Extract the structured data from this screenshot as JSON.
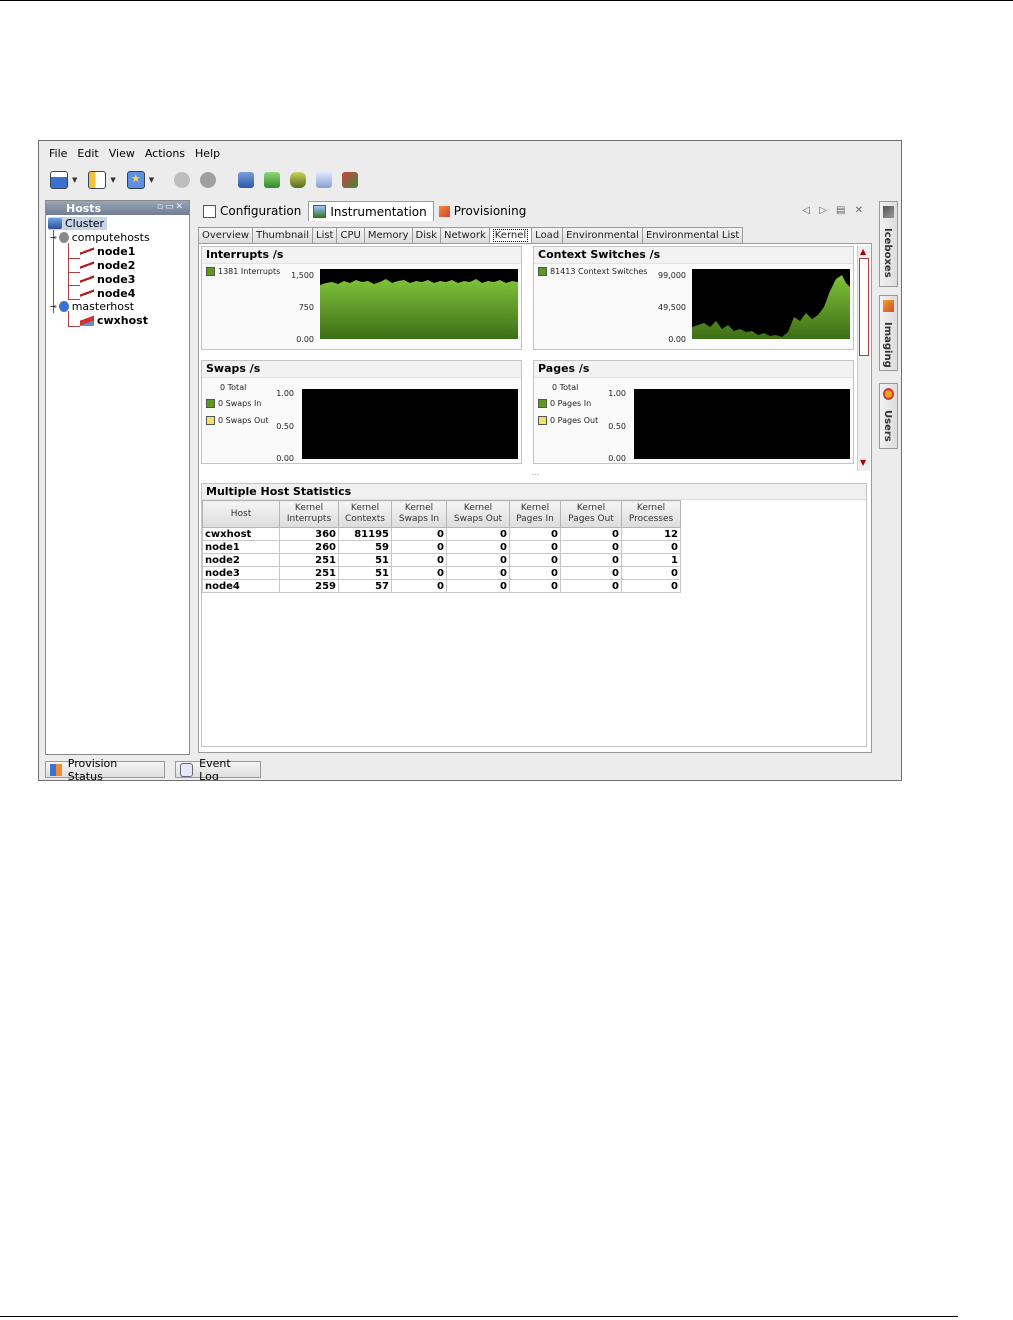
{
  "menu": [
    "File",
    "Edit",
    "View",
    "Actions",
    "Help"
  ],
  "hosts": {
    "title": "Hosts",
    "tree": [
      {
        "label": "Cluster",
        "level": 0
      },
      {
        "label": "computehosts",
        "level": 1
      },
      {
        "label": "node1",
        "level": 2
      },
      {
        "label": "node2",
        "level": 2
      },
      {
        "label": "node3",
        "level": 2
      },
      {
        "label": "node4",
        "level": 2
      },
      {
        "label": "masterhost",
        "level": 1
      },
      {
        "label": "cwxhost",
        "level": 2
      }
    ]
  },
  "main_tabs": [
    {
      "label": "Configuration",
      "selected": false
    },
    {
      "label": "Instrumentation",
      "selected": true
    },
    {
      "label": "Provisioning",
      "selected": false
    }
  ],
  "sub_tabs": [
    {
      "label": "Overview"
    },
    {
      "label": "Thumbnail"
    },
    {
      "label": "List"
    },
    {
      "label": "CPU"
    },
    {
      "label": "Memory"
    },
    {
      "label": "Disk"
    },
    {
      "label": "Network"
    },
    {
      "label": "Kernel",
      "selected": true
    },
    {
      "label": "Load"
    },
    {
      "label": "Environmental"
    },
    {
      "label": "Environmental List"
    }
  ],
  "graphs": {
    "interrupts": {
      "title": "Interrupts /s",
      "legend": [
        {
          "label": "1381 Interrupts",
          "color": "#5c9a1a"
        }
      ],
      "yticks": [
        "1,500",
        "750",
        "0.00"
      ]
    },
    "context": {
      "title": "Context Switches /s",
      "legend": [
        {
          "label": "81413 Context Switches",
          "color": "#5c9a1a"
        }
      ],
      "yticks": [
        "99,000",
        "49,500",
        "0.00"
      ]
    },
    "swaps": {
      "title": "Swaps /s",
      "total": "0 Total",
      "legend": [
        {
          "label": "0 Swaps In",
          "color": "#5c9a1a"
        },
        {
          "label": "0 Swaps Out",
          "color": "#f1e26a"
        }
      ],
      "yticks": [
        "1.00",
        "0.50",
        "0.00"
      ]
    },
    "pages": {
      "title": "Pages /s",
      "total": "0 Total",
      "legend": [
        {
          "label": "0 Pages In",
          "color": "#5c9a1a"
        },
        {
          "label": "0 Pages Out",
          "color": "#f1e26a"
        }
      ],
      "yticks": [
        "1.00",
        "0.50",
        "0.00"
      ]
    }
  },
  "stats": {
    "title": "Multiple Host Statistics",
    "headers": [
      "Host",
      "Kernel Interrupts",
      "Kernel Contexts",
      "Kernel Swaps In",
      "Kernel Swaps Out",
      "Kernel Pages In",
      "Kernel Pages Out",
      "Kernel Processes"
    ],
    "rows": [
      [
        "cwxhost",
        "360",
        "81195",
        "0",
        "0",
        "0",
        "0",
        "12"
      ],
      [
        "node1",
        "260",
        "59",
        "0",
        "0",
        "0",
        "0",
        "0"
      ],
      [
        "node2",
        "251",
        "51",
        "0",
        "0",
        "0",
        "0",
        "1"
      ],
      [
        "node3",
        "251",
        "51",
        "0",
        "0",
        "0",
        "0",
        "0"
      ],
      [
        "node4",
        "259",
        "57",
        "0",
        "0",
        "0",
        "0",
        "0"
      ]
    ]
  },
  "right_tabs": [
    "Iceboxes",
    "Imaging",
    "Users"
  ],
  "bottom_tabs": [
    "Provision Status",
    "Event Log"
  ],
  "colors": {
    "accent_green": "#5c9a1a",
    "plot_bg": "#000000",
    "tree_line": "#b04040"
  }
}
